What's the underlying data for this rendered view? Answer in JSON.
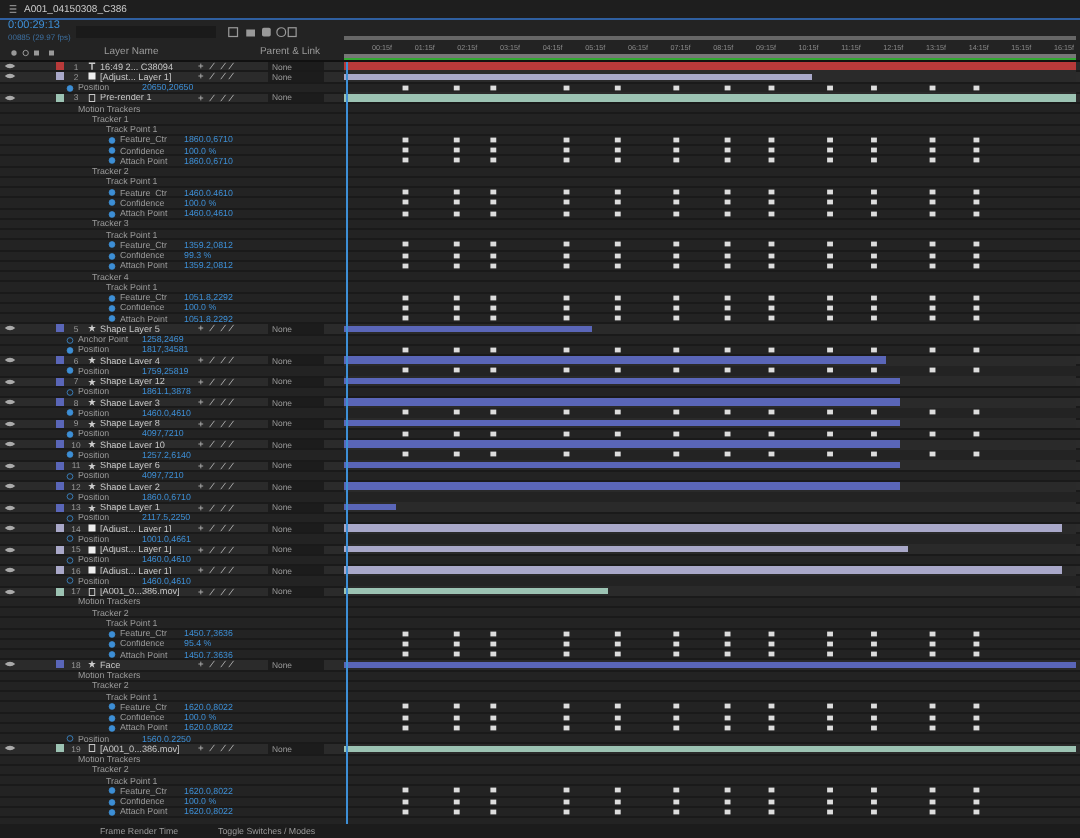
{
  "comp_tab": {
    "title": "A001_04150308_C386"
  },
  "timecode": {
    "time": "0:00:29:13",
    "frames": "00885 (29.97 fps)"
  },
  "columns": {
    "layer_name": "Layer Name",
    "parent": "Parent & Link"
  },
  "ruler": [
    "00:15f",
    "01:15f",
    "02:15f",
    "03:15f",
    "04:15f",
    "05:15f",
    "06:15f",
    "07:15f",
    "08:15f",
    "09:15f",
    "10:15f",
    "11:15f",
    "12:15f",
    "13:15f",
    "14:15f",
    "15:15f",
    "16:15f"
  ],
  "layers": [
    {
      "kind": "text_layer",
      "num": "1",
      "name": "16:49 2... C38094",
      "color": "#b83a3a",
      "parent": "None",
      "level": 1
    },
    {
      "kind": "adjustment_layer",
      "num": "2",
      "name": "[Adjust... Layer 1]",
      "color": "#a9a8c9",
      "parent": "None",
      "level": 0.64,
      "children": [
        {
          "kind": "prop",
          "name": "Position",
          "value": "20650,20650",
          "animated": true
        }
      ]
    },
    {
      "kind": "precomp_layer",
      "num": "3",
      "name": "Pre-render 1",
      "color": "#9cc3b3",
      "parent": "None",
      "level": 1,
      "children": [
        {
          "kind": "group",
          "name": "Motion Trackers",
          "children": [
            {
              "kind": "group",
              "name": "Tracker 1",
              "children": [
                {
                  "kind": "group",
                  "name": "Track Point 1",
                  "children": [
                    {
                      "kind": "prop",
                      "name": "Feature_Ctr",
                      "value": "1860.0,6710",
                      "animated": true
                    },
                    {
                      "kind": "prop",
                      "name": "Confidence",
                      "value": "100.0 %",
                      "animated": true
                    },
                    {
                      "kind": "prop",
                      "name": "Attach Point",
                      "value": "1860.0,6710",
                      "animated": true
                    }
                  ]
                }
              ]
            },
            {
              "kind": "group",
              "name": "Tracker 2",
              "children": [
                {
                  "kind": "group",
                  "name": "Track Point 1",
                  "children": [
                    {
                      "kind": "prop",
                      "name": "Feature_Ctr",
                      "value": "1460.0,4610",
                      "animated": true
                    },
                    {
                      "kind": "prop",
                      "name": "Confidence",
                      "value": "100.0 %",
                      "animated": true
                    },
                    {
                      "kind": "prop",
                      "name": "Attach Point",
                      "value": "1460.0,4610",
                      "animated": true
                    }
                  ]
                }
              ]
            },
            {
              "kind": "group",
              "name": "Tracker 3",
              "children": [
                {
                  "kind": "group",
                  "name": "Track Point 1",
                  "children": [
                    {
                      "kind": "prop",
                      "name": "Feature_Ctr",
                      "value": "1359.2,0812",
                      "animated": true
                    },
                    {
                      "kind": "prop",
                      "name": "Confidence",
                      "value": "99.3 %",
                      "animated": true
                    },
                    {
                      "kind": "prop",
                      "name": "Attach Point",
                      "value": "1359.2,0812",
                      "animated": true
                    }
                  ]
                }
              ]
            },
            {
              "kind": "group",
              "name": "Tracker 4",
              "children": [
                {
                  "kind": "group",
                  "name": "Track Point 1",
                  "children": [
                    {
                      "kind": "prop",
                      "name": "Feature_Ctr",
                      "value": "1051.8,2292",
                      "animated": true
                    },
                    {
                      "kind": "prop",
                      "name": "Confidence",
                      "value": "100.0 %",
                      "animated": true
                    },
                    {
                      "kind": "prop",
                      "name": "Attach Point",
                      "value": "1051.8,2292",
                      "animated": true
                    }
                  ]
                }
              ]
            }
          ]
        }
      ]
    },
    {
      "kind": "shape_layer",
      "num": "5",
      "name": "Shape Layer 5",
      "color": "#5a66b8",
      "parent": "None",
      "level": 0.34,
      "children": [
        {
          "kind": "prop",
          "name": "Anchor Point",
          "value": "1258,2469",
          "animated": false
        },
        {
          "kind": "prop",
          "name": "Position",
          "value": "1817,34581",
          "animated": true
        }
      ]
    },
    {
      "kind": "shape_layer",
      "num": "6",
      "name": "Shape Layer 4",
      "color": "#5a66b8",
      "parent": "None",
      "level": 0.74,
      "children": [
        {
          "kind": "prop",
          "name": "Position",
          "value": "1759,25819",
          "animated": true
        }
      ]
    },
    {
      "kind": "shape_layer",
      "num": "7",
      "name": "Shape Layer 12",
      "color": "#5a66b8",
      "parent": "None",
      "level": 0.76,
      "children": [
        {
          "kind": "prop",
          "name": "Position",
          "value": "1861.1,3878",
          "animated": false
        }
      ]
    },
    {
      "kind": "shape_layer",
      "num": "8",
      "name": "Shape Layer 3",
      "color": "#5a66b8",
      "parent": "None",
      "level": 0.76,
      "children": [
        {
          "kind": "prop",
          "name": "Position",
          "value": "1460.0,4610",
          "animated": true
        }
      ]
    },
    {
      "kind": "shape_layer",
      "num": "9",
      "name": "Shape Layer 8",
      "color": "#5a66b8",
      "parent": "None",
      "level": 0.76,
      "children": [
        {
          "kind": "prop",
          "name": "Position",
          "value": "4097,7210",
          "animated": true
        }
      ]
    },
    {
      "kind": "shape_layer",
      "num": "10",
      "name": "Shape Layer 10",
      "color": "#5a66b8",
      "parent": "None",
      "level": 0.76,
      "children": [
        {
          "kind": "prop",
          "name": "Position",
          "value": "1257.2,6140",
          "animated": true
        }
      ]
    },
    {
      "kind": "shape_layer",
      "num": "11",
      "name": "Shape Layer 6",
      "color": "#5a66b8",
      "parent": "None",
      "level": 0.76,
      "children": [
        {
          "kind": "prop",
          "name": "Position",
          "value": "4097,7210",
          "animated": false
        }
      ]
    },
    {
      "kind": "shape_layer",
      "num": "12",
      "name": "Shape Layer 2",
      "color": "#5a66b8",
      "parent": "None",
      "level": 0.76,
      "children": [
        {
          "kind": "prop",
          "name": "Position",
          "value": "1860.0,6710",
          "animated": false
        }
      ]
    },
    {
      "kind": "shape_layer",
      "num": "13",
      "name": "Shape Layer 1",
      "color": "#5a66b8",
      "parent": "None",
      "level": 0.07,
      "children": [
        {
          "kind": "prop",
          "name": "Position",
          "value": "2117.5,2250",
          "animated": false
        }
      ]
    },
    {
      "kind": "adjustment_layer",
      "num": "14",
      "name": "[Adjust... Layer 1]",
      "color": "#a9a8c9",
      "parent": "None",
      "level": 0.98,
      "children": [
        {
          "kind": "prop",
          "name": "Position",
          "value": "1001.0,4661",
          "animated": false
        }
      ]
    },
    {
      "kind": "adjustment_layer",
      "num": "15",
      "name": "[Adjust... Layer 1]",
      "color": "#a9a8c9",
      "parent": "None",
      "level": 0.77,
      "children": [
        {
          "kind": "prop",
          "name": "Position",
          "value": "1460.0,4610",
          "animated": false
        }
      ]
    },
    {
      "kind": "adjustment_layer",
      "num": "16",
      "name": "[Adjust... Layer 1]",
      "color": "#a9a8c9",
      "parent": "None",
      "level": 0.98,
      "children": [
        {
          "kind": "prop",
          "name": "Position",
          "value": "1460.0,4610",
          "animated": false
        }
      ]
    },
    {
      "kind": "footage_layer",
      "num": "17",
      "name": "[A001_0...386.mov]",
      "color": "#9cc3b3",
      "parent": "None",
      "level": 0.36,
      "children": [
        {
          "kind": "group",
          "name": "Motion Trackers",
          "children": [
            {
              "kind": "group",
              "name": "Tracker 2",
              "children": [
                {
                  "kind": "group",
                  "name": "Track Point 1",
                  "children": [
                    {
                      "kind": "prop",
                      "name": "Feature_Ctr",
                      "value": "1450.7,3636",
                      "animated": true
                    },
                    {
                      "kind": "prop",
                      "name": "Confidence",
                      "value": "95.4 %",
                      "animated": true
                    },
                    {
                      "kind": "prop",
                      "name": "Attach Point",
                      "value": "1450.7,3636",
                      "animated": true
                    }
                  ]
                }
              ]
            }
          ]
        }
      ]
    },
    {
      "kind": "shape_layer",
      "num": "18",
      "name": "Face",
      "color": "#5a66b8",
      "parent": "None",
      "level": 1,
      "children": [
        {
          "kind": "group",
          "name": "Motion Trackers",
          "children": [
            {
              "kind": "group",
              "name": "Tracker 2",
              "children": [
                {
                  "kind": "group",
                  "name": "Track Point 1",
                  "children": [
                    {
                      "kind": "prop",
                      "name": "Feature_Ctr",
                      "value": "1620.0,8022",
                      "animated": true
                    },
                    {
                      "kind": "prop",
                      "name": "Confidence",
                      "value": "100.0 %",
                      "animated": true
                    },
                    {
                      "kind": "prop",
                      "name": "Attach Point",
                      "value": "1620.0,8022",
                      "animated": true
                    }
                  ]
                }
              ]
            }
          ]
        },
        {
          "kind": "prop",
          "name": "Position",
          "value": "1560.0,2250",
          "animated": false
        }
      ]
    },
    {
      "kind": "footage_layer",
      "num": "19",
      "name": "[A001_0...386.mov]",
      "color": "#9cc3b3",
      "parent": "None",
      "level": 1,
      "children": [
        {
          "kind": "group",
          "name": "Motion Trackers",
          "children": [
            {
              "kind": "group",
              "name": "Tracker 2",
              "children": [
                {
                  "kind": "group",
                  "name": "Track Point 1",
                  "children": [
                    {
                      "kind": "prop",
                      "name": "Feature_Ctr",
                      "value": "1620.0,8022",
                      "animated": true
                    },
                    {
                      "kind": "prop",
                      "name": "Confidence",
                      "value": "100.0 %",
                      "animated": true
                    },
                    {
                      "kind": "prop",
                      "name": "Attach Point",
                      "value": "1620.0,8022",
                      "animated": true
                    }
                  ]
                }
              ]
            }
          ]
        }
      ]
    }
  ],
  "footer": {
    "render_label": "Frame Render Time",
    "toggle": "Toggle Switches / Modes"
  }
}
